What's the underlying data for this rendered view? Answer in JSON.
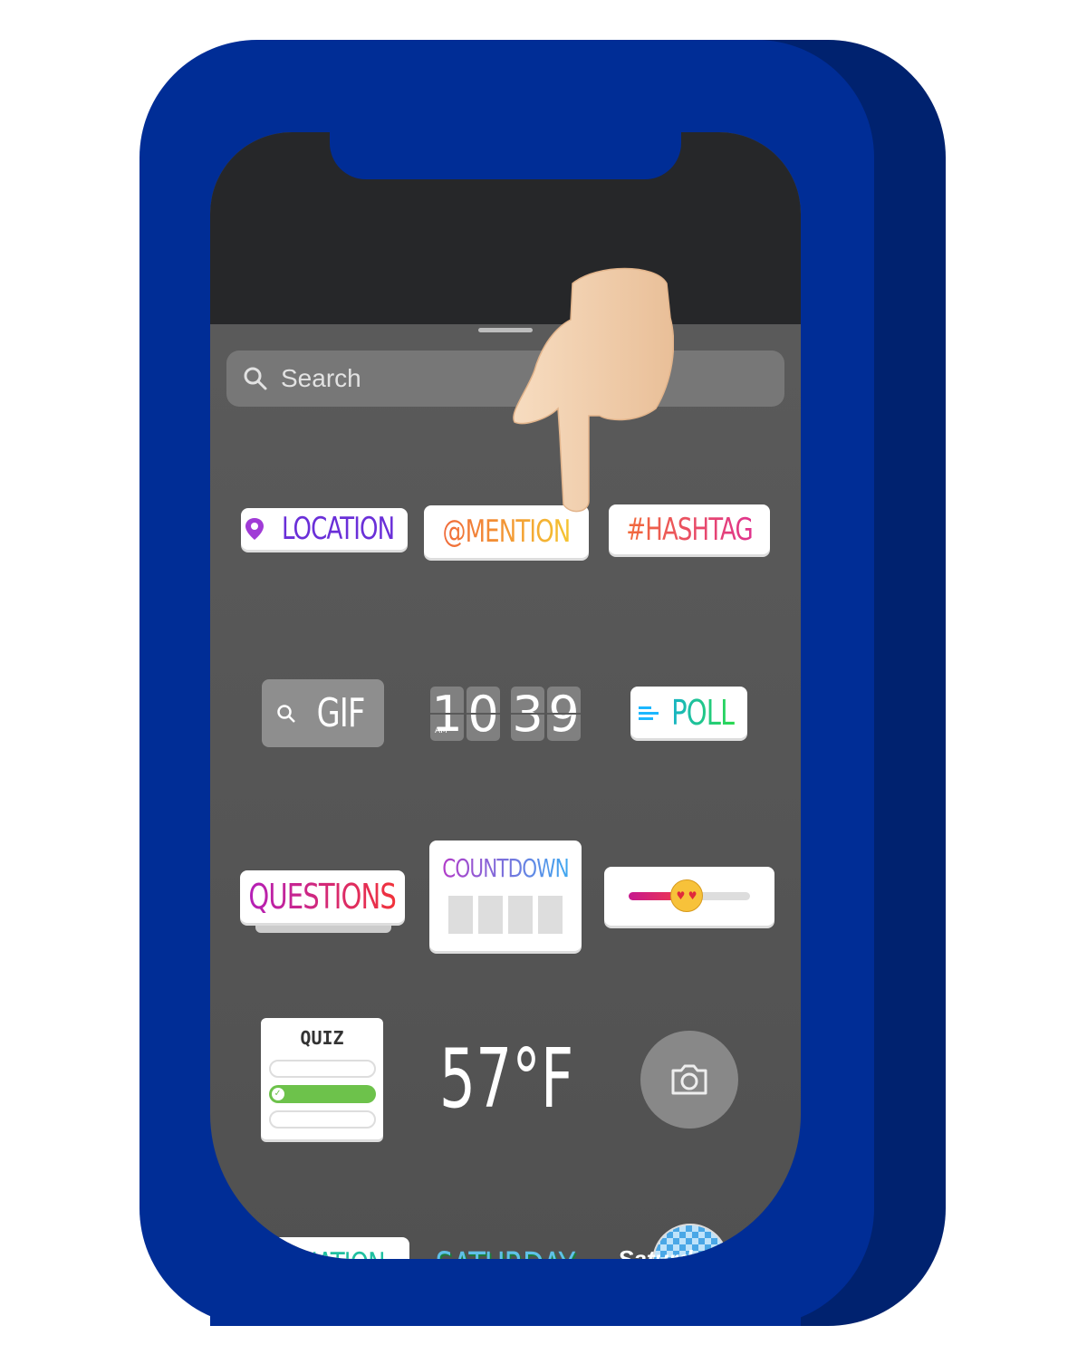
{
  "search": {
    "placeholder": "Search",
    "icon": "search-icon"
  },
  "stickers": {
    "location": "LOCATION",
    "mention": "@MENTION",
    "hashtag": "#HASHTAG",
    "gif": "GIF",
    "clock": {
      "d1": "1",
      "d2": "0",
      "d3": "3",
      "d4": "9",
      "ampm": "AM"
    },
    "poll": "POLL",
    "questions": "QUESTIONS",
    "countdown": "COUNTDOWN",
    "slider_emoji": "heart-eyes-emoji",
    "quiz": "QUIZ",
    "temperature": "57°F",
    "camera": "camera-icon",
    "donation": "DONATION",
    "saturday": "SATURDAY",
    "disco": "Saturday"
  },
  "colors": {
    "phone": "#002d96",
    "phone_shadow": "#00226f",
    "screen_top": "#262729",
    "sheet": "#5a5a5a"
  }
}
